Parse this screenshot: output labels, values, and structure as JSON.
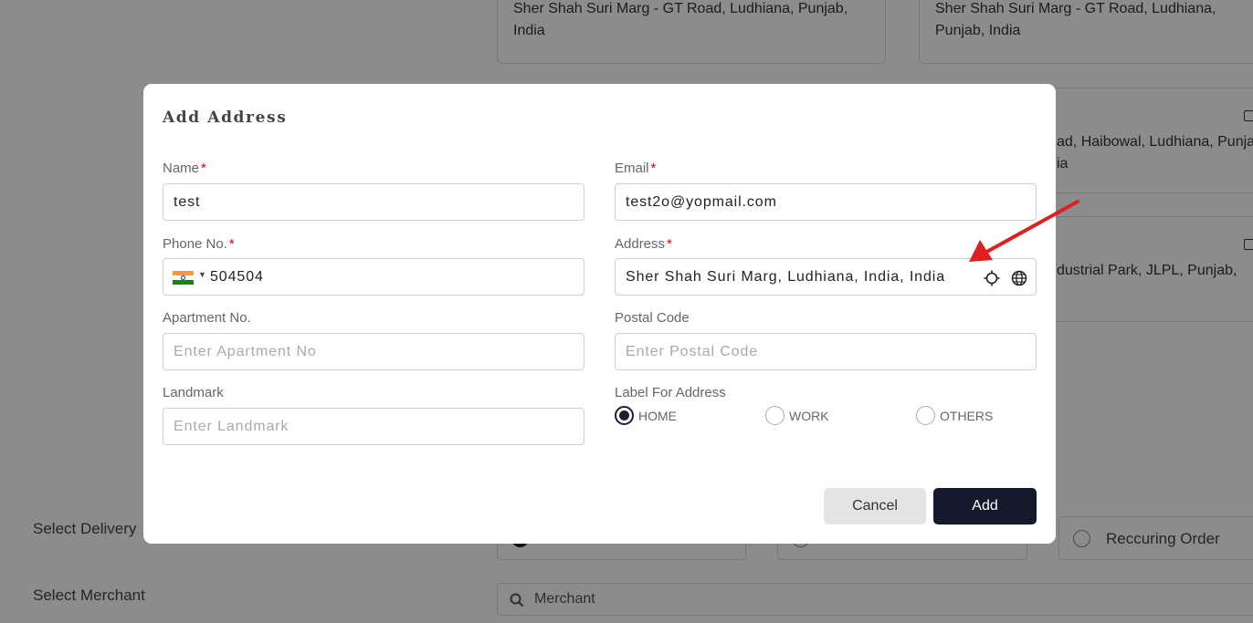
{
  "background": {
    "top_cards": [
      {
        "text": "Sher Shah Suri Marg - GT Road, Ludhiana, Punjab, India"
      },
      {
        "text": "Sher Shah Suri Marg - GT Road, Ludhiana, Punjab, India"
      }
    ],
    "side_cards": [
      {
        "text": "ad, Haibowal, Ludhiana, Punja",
        "text2": "ia"
      },
      {
        "text": "dustrial Park, JLPL, Punjab,"
      }
    ],
    "select_delivery_label": "Select Delivery",
    "select_merchant_label": "Select Merchant",
    "recurring_order_label": "Reccuring Order",
    "merchant_placeholder": "Merchant"
  },
  "modal": {
    "title": "Add Address",
    "name": {
      "label": "Name",
      "required": "*",
      "value": "test"
    },
    "email": {
      "label": "Email",
      "required": "*",
      "value": "test2o@yopmail.com"
    },
    "phone": {
      "label": "Phone No.",
      "required": "*",
      "value": "504504"
    },
    "address": {
      "label": "Address",
      "required": "*",
      "value": "Sher Shah Suri Marg, Ludhiana, India, India"
    },
    "apartment": {
      "label": "Apartment No.",
      "placeholder": "Enter Apartment No"
    },
    "postal": {
      "label": "Postal Code",
      "placeholder": "Enter Postal Code"
    },
    "landmark": {
      "label": "Landmark",
      "placeholder": "Enter Landmark"
    },
    "address_label": {
      "label": "Label For Address",
      "options": [
        "HOME",
        "WORK",
        "OTHERS"
      ],
      "selected": "HOME"
    },
    "cancel_label": "Cancel",
    "add_label": "Add"
  },
  "colors": {
    "primary_button": "#121a2b",
    "required_mark": "#e00000",
    "annotation_arrow": "#e02020"
  },
  "icons": [
    "india-flag-icon",
    "crosshair-icon",
    "globe-icon",
    "search-icon",
    "edit-icon"
  ]
}
